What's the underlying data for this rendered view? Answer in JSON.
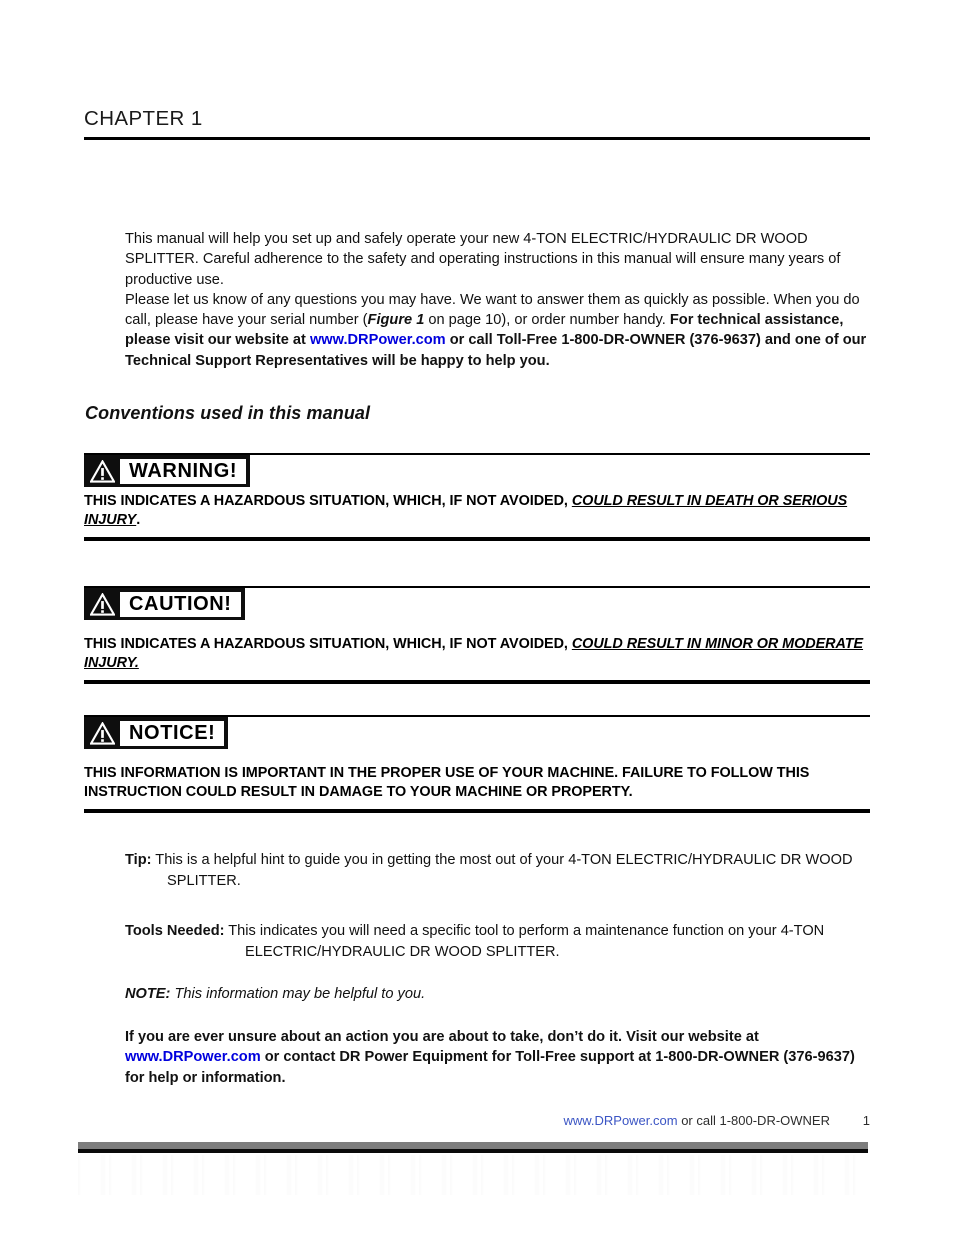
{
  "header": {
    "chapter_title": "CHAPTER 1"
  },
  "intro": {
    "paragraph1_part1": "This manual will help you set up and safely operate your new 4-TON ELECTRIC/HYDRAULIC DR WOOD SPLITTER. Careful adherence to the safety and operating instructions in this manual will ensure many years of productive use.",
    "paragraph2_part1": "Please let us know of any questions you may have.  We want to answer them as quickly as possible.  When you do call, please have your serial number (",
    "figure_ref": "Figure 1",
    "paragraph2_part2": " on page 10), or order number handy.  ",
    "paragraph2_bold1": "For technical assistance, please visit our website at ",
    "link_text": "www.DRPower.com",
    "paragraph2_bold2": " or call Toll-Free 1-800-DR-OWNER (376-9637) and one of our Technical Support Representatives will be happy to help you."
  },
  "conventions": {
    "heading": "Conventions used in this manual"
  },
  "alerts": [
    {
      "badge_label": "WARNING!",
      "icon": "warning-triangle-icon",
      "body_plain": "THIS INDICATES A HAZARDOUS SITUATION, WHICH, IF NOT AVOIDED, ",
      "body_emph": "COULD RESULT IN DEATH OR SERIOUS INJURY",
      "body_tail": "."
    },
    {
      "badge_label": "CAUTION!",
      "icon": "warning-triangle-icon",
      "body_plain": "THIS INDICATES A HAZARDOUS SITUATION, WHICH, IF NOT AVOIDED, ",
      "body_emph": "COULD RESULT IN MINOR OR MODERATE INJURY.",
      "body_tail": ""
    },
    {
      "badge_label": "NOTICE!",
      "icon": "warning-triangle-icon",
      "body_plain": "THIS INFORMATION IS IMPORTANT IN THE PROPER USE OF YOUR MACHINE.  FAILURE TO FOLLOW THIS INSTRUCTION COULD RESULT IN DAMAGE TO YOUR MACHINE OR PROPERTY.",
      "body_emph": "",
      "body_tail": ""
    }
  ],
  "tips": {
    "tip_label": "Tip:",
    "tip_text": "This is a helpful hint to guide you in getting the most out of your 4-TON ELECTRIC/HYDRAULIC DR WOOD SPLITTER.",
    "tools_label": "Tools Needed:",
    "tools_text": "This indicates you will need a specific tool to perform a maintenance function on your 4-TON ELECTRIC/HYDRAULIC DR WOOD SPLITTER.",
    "note_label": "NOTE:",
    "note_text": "This information may be helpful to you.",
    "closing_part1": "If you are ever unsure about an action you are about to take, don’t do it.  Visit our website at ",
    "closing_link": "www.DRPower.com",
    "closing_part2": " or contact DR Power Equipment for Toll-Free support at 1-800-DR-OWNER (376-9637) for help or information."
  },
  "footer": {
    "link": "www.DRPower.com",
    "text": " or call 1-800-DR-OWNER",
    "page_number": "1"
  },
  "colors": {
    "link_blue": "#0000dd",
    "footer_link_blue": "#3b55c4",
    "badge_black": "#0e0e0e",
    "footer_grey": "#7d7d7d"
  }
}
